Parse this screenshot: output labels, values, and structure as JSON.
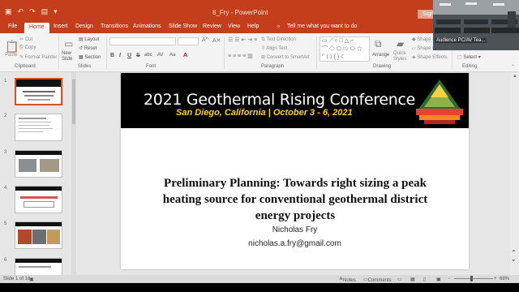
{
  "window": {
    "doc_title": "8_Fry - PowerPoint",
    "sign_in_label": "Sign",
    "qat_icons": [
      "save-icon",
      "undo-icon",
      "redo-icon",
      "present-icon",
      "customize-icon"
    ]
  },
  "tabs": [
    "File",
    "Home",
    "Insert",
    "Design",
    "Transitions",
    "Animations",
    "Slide Show",
    "Review",
    "View",
    "Help"
  ],
  "active_tab": "Home",
  "tell_me": "Tell me what you want to do",
  "ribbon": {
    "clipboard": {
      "label": "Clipboard",
      "paste": "Paste",
      "cut": "Cut",
      "copy": "Copy",
      "format_painter": "Format Painter"
    },
    "slides": {
      "label": "Slides",
      "new_slide": "New Slide",
      "layout": "Layout",
      "reset": "Reset",
      "section": "Section"
    },
    "font": {
      "label": "Font",
      "buttons": [
        "B",
        "I",
        "U",
        "S",
        "abc",
        "AV",
        "Aa",
        "A"
      ]
    },
    "paragraph": {
      "label": "Paragraph",
      "text_direction": "Text Direction",
      "align_text": "Align Text",
      "smartart": "Convert to SmartArt"
    },
    "drawing": {
      "label": "Drawing",
      "arrange": "Arrange",
      "quick_styles": "Quick Styles",
      "shape_fill": "Shape Fill",
      "shape_outline": "Shape Outline",
      "shape_effects": "Shape Effects"
    },
    "editing": {
      "label": "Editing",
      "select": "Select"
    }
  },
  "thumbnails": [
    {
      "num": "1",
      "selected": true
    },
    {
      "num": "2",
      "selected": false
    },
    {
      "num": "3",
      "selected": false
    },
    {
      "num": "4",
      "selected": false
    },
    {
      "num": "5",
      "selected": false
    },
    {
      "num": "6",
      "selected": false
    }
  ],
  "slide": {
    "banner_title": "2021 Geothermal Rising Conference",
    "banner_subtitle": "San Diego, California | October 3 - 6, 2021",
    "title": "Preliminary Planning: Towards right sizing a peak heating source for conventional geothermal district energy projects",
    "author": "Nicholas Fry",
    "email": "nicholas.a.fry@gmail.com"
  },
  "status": {
    "slide_info": "Slide 1 of 16",
    "notes": "Notes",
    "comments": "Comments",
    "zoom": "68%"
  },
  "webcam": {
    "label": "Audience PC/AV Tea..."
  },
  "colors": {
    "accent": "#c43e1c",
    "banner": "#000000",
    "subtitle": "#ffd21a"
  }
}
